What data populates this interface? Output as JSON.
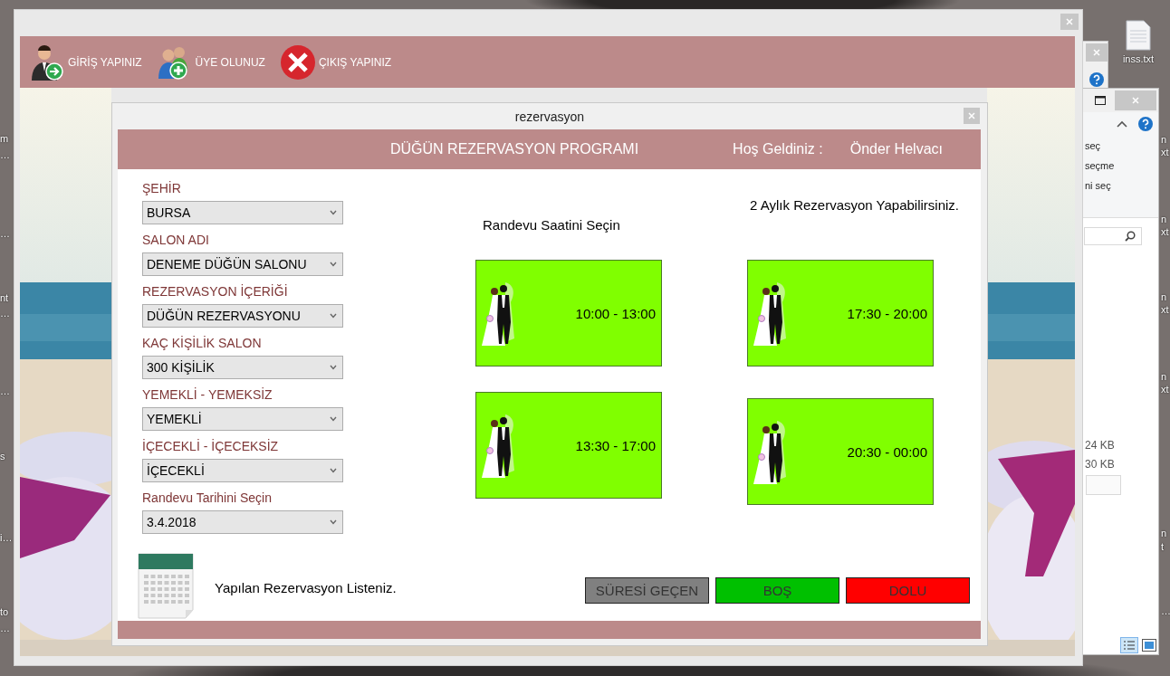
{
  "desktop": {
    "left_edge_labels": [
      "m",
      "…",
      "…",
      "nt",
      "…",
      "…",
      "s",
      "i…",
      "to",
      "…"
    ],
    "right_edge_labels": [
      "n",
      "xt",
      "n",
      "xt",
      "n",
      "xt",
      "n",
      "xt",
      "n",
      "t",
      "…"
    ],
    "icons": [
      {
        "label": "inss.txt"
      }
    ]
  },
  "explorer_window": {
    "ribbon_items": [
      "seç",
      "seçme",
      "ni seç"
    ],
    "sizes": [
      "24 KB",
      "30 KB"
    ]
  },
  "main_window": {
    "toolbar": [
      {
        "label": "GİRİŞ YAPINIZ",
        "kind": "login"
      },
      {
        "label": "ÜYE OLUNUZ",
        "kind": "register"
      },
      {
        "label": "ÇIKIŞ YAPINIZ",
        "kind": "exit"
      }
    ]
  },
  "dialog": {
    "title": "rezervasyon",
    "header": {
      "title": "DÜĞÜN REZERVASYON PROGRAMI",
      "welcome": "Hoş Geldiniz :",
      "user": "Önder Helvacı"
    },
    "fields": [
      {
        "label": "ŞEHİR",
        "value": "BURSA"
      },
      {
        "label": "SALON ADI",
        "value": "DENEME DÜĞÜN SALONU"
      },
      {
        "label": "REZERVASYON İÇERİĞİ",
        "value": "DÜĞÜN REZERVASYONU"
      },
      {
        "label": "KAÇ KİŞİLİK SALON",
        "value": "300 KİŞİLİK"
      },
      {
        "label": "YEMEKLİ - YEMEKSİZ",
        "value": "YEMEKLİ"
      },
      {
        "label": "İÇECEKLİ - İÇECEKSİZ",
        "value": "İÇECEKLİ"
      },
      {
        "label": "Randevu Tarihini Seçin",
        "value": "3.4.2018"
      }
    ],
    "note": "2 Aylık Rezervasyon Yapabilirsiniz.",
    "slots_title": "Randevu Saatini Seçin",
    "slots": [
      {
        "time": "10:00 - 13:00",
        "color": "#80ff00"
      },
      {
        "time": "17:30 - 20:00",
        "color": "#80ff00"
      },
      {
        "time": "13:30 - 17:00",
        "color": "#80ff00"
      },
      {
        "time": "20:30 - 00:00",
        "color": "#80ff00"
      }
    ],
    "list_link": "Yapılan Rezervasyon Listeniz.",
    "legend": [
      {
        "label": "SÜRESİ GEÇEN",
        "color": "#808080"
      },
      {
        "label": "BOŞ",
        "color": "#00c000"
      },
      {
        "label": "DOLU",
        "color": "#ff0000"
      }
    ]
  }
}
